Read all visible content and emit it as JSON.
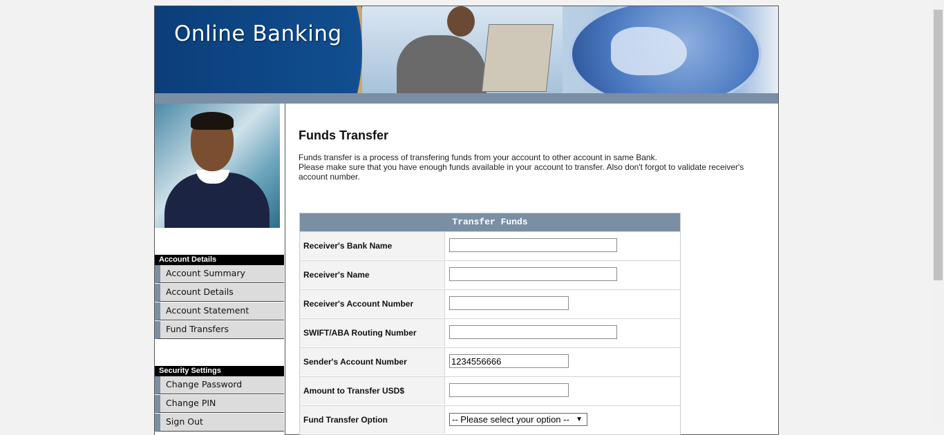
{
  "header": {
    "title": "Online Banking"
  },
  "sidebar": {
    "account_heading": "Account Details",
    "account_items": [
      "Account Summary",
      "Account Details",
      "Account Statement",
      "Fund Transfers"
    ],
    "security_heading": "Security Settings",
    "security_items": [
      "Change Password",
      "Change PIN",
      "Sign Out"
    ]
  },
  "main": {
    "title": "Funds Transfer",
    "desc_line1": "Funds transfer is a process of transfering funds from your account to other account in same Bank.",
    "desc_line2": "Please make sure that you have enough funds available in your account to transfer. Also don't forgot to validate receiver's account number."
  },
  "form": {
    "heading": "Transfer Funds",
    "fields": [
      {
        "label": "Receiver's Bank Name",
        "value": ""
      },
      {
        "label": "Receiver's Name",
        "value": ""
      },
      {
        "label": "Receiver's Account Number",
        "value": ""
      },
      {
        "label": "SWIFT/ABA Routing Number",
        "value": ""
      },
      {
        "label": "Sender's Account Number",
        "value": "1234556666"
      },
      {
        "label": "Amount to Transfer USD$",
        "value": ""
      }
    ],
    "option_label": "Fund Transfer Option",
    "option_selected": "-- Please select your option --"
  },
  "icons": {
    "select_caret": "caret-down-icon"
  }
}
